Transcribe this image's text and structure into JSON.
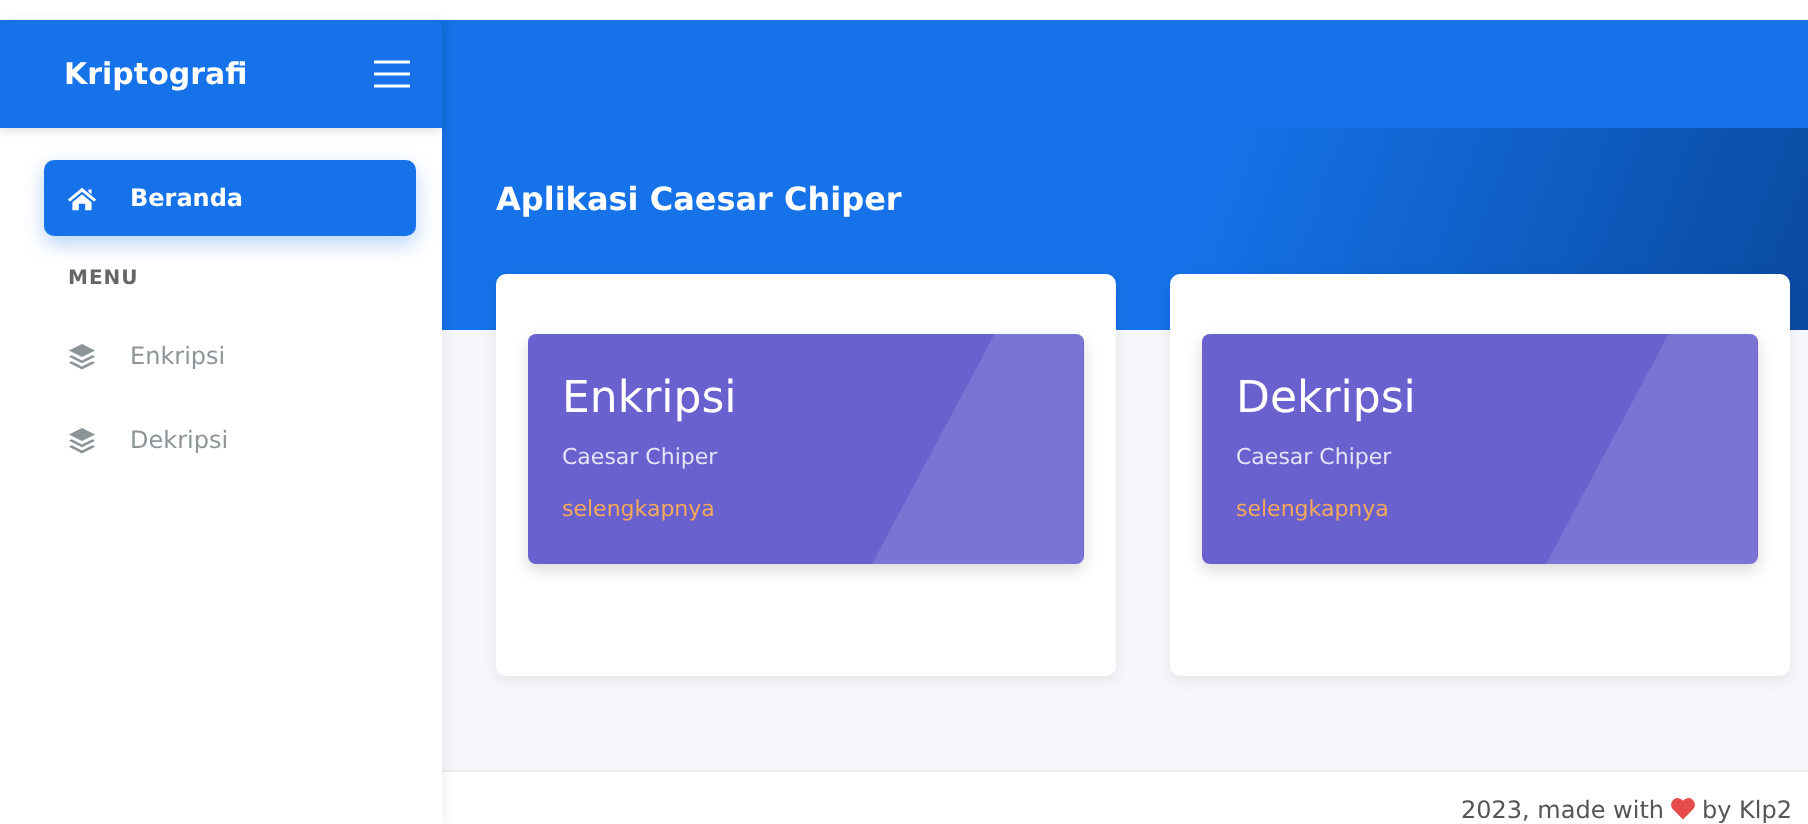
{
  "brand": "Kriptografi",
  "sidebar": {
    "items": [
      {
        "label": "Beranda",
        "kind": "home",
        "selected": true
      }
    ],
    "section": "MENU",
    "menu": [
      {
        "label": "Enkripsi",
        "kind": "layers",
        "selected": false
      },
      {
        "label": "Dekripsi",
        "kind": "layers",
        "selected": false
      }
    ]
  },
  "page_title": "Aplikasi Caesar Chiper",
  "cards": [
    {
      "title": "Enkripsi",
      "subtitle": "Caesar Chiper",
      "link": "selengkapnya"
    },
    {
      "title": "Dekripsi",
      "subtitle": "Caesar Chiper",
      "link": "selengkapnya"
    }
  ],
  "footer": {
    "before": "2023, made with",
    "after": "by Klp2"
  }
}
